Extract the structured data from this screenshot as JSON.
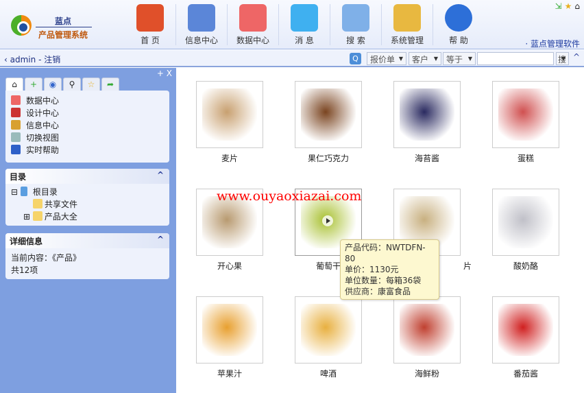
{
  "header": {
    "brand_top": "蓝点",
    "brand_bottom": "产品管理系统",
    "software_link": "· 蓝点管理软件",
    "nav": [
      {
        "label": "首 页",
        "icon": "home-icon",
        "color": "#e0502a"
      },
      {
        "label": "信息中心",
        "icon": "faces-icon",
        "color": "#5b86d8"
      },
      {
        "label": "数据中心",
        "icon": "grid-icon",
        "color": "#e66"
      },
      {
        "label": "消 息",
        "icon": "chat-icon",
        "color": "#3fb0f0"
      },
      {
        "label": "搜 索",
        "icon": "search-folder-icon",
        "color": "#7fb0e8"
      },
      {
        "label": "系统管理",
        "icon": "tools-icon",
        "color": "#e8b840"
      },
      {
        "label": "帮 助",
        "icon": "help-icon",
        "color": "#2d6fd8"
      }
    ]
  },
  "toolbar": {
    "user": "admin",
    "logout": "注销",
    "select1": "报价单",
    "select2": "客户",
    "select3": "等于",
    "search_value": "",
    "search_button": "搜"
  },
  "sidebar": {
    "controls": "+ X",
    "quick": [
      {
        "label": "数据中心",
        "color": "#e66"
      },
      {
        "label": "设计中心",
        "color": "#c33"
      },
      {
        "label": "信息中心",
        "color": "#d8a030"
      },
      {
        "label": "切换视图",
        "color": "#9bb"
      },
      {
        "label": "实时帮助",
        "color": "#2d5fc8"
      }
    ],
    "tree_title": "目录",
    "tree": {
      "root": "根目录",
      "children": [
        "共享文件",
        "产品大全"
      ]
    },
    "detail_title": "详细信息",
    "detail_current": "当前内容：《产品》",
    "detail_count": "共12项"
  },
  "products": [
    {
      "name": "麦片",
      "color": "#c8a070"
    },
    {
      "name": "果仁巧克力",
      "color": "#7a4420"
    },
    {
      "name": "海苔酱",
      "color": "#2a2a60"
    },
    {
      "name": "蛋糕",
      "color": "#d05050"
    },
    {
      "name": "开心果",
      "color": "#b89a70"
    },
    {
      "name": "葡萄干",
      "color": "#a8c030"
    },
    {
      "name": "片",
      "color": "#c8b080"
    },
    {
      "name": "酸奶酪",
      "color": "#c0c0c8"
    },
    {
      "name": "苹果汁",
      "color": "#e8a030"
    },
    {
      "name": "啤酒",
      "color": "#e8b040"
    },
    {
      "name": "海鲜粉",
      "color": "#c04030"
    },
    {
      "name": "番茄酱",
      "color": "#d02020"
    }
  ],
  "watermark": "www.ouyaoxiazai.com",
  "tooltip": {
    "code": "产品代码：NWTDFN-80",
    "price": "单价：1130元",
    "unit": "单位数量：每箱36袋",
    "supplier": "供应商：康富食品"
  }
}
